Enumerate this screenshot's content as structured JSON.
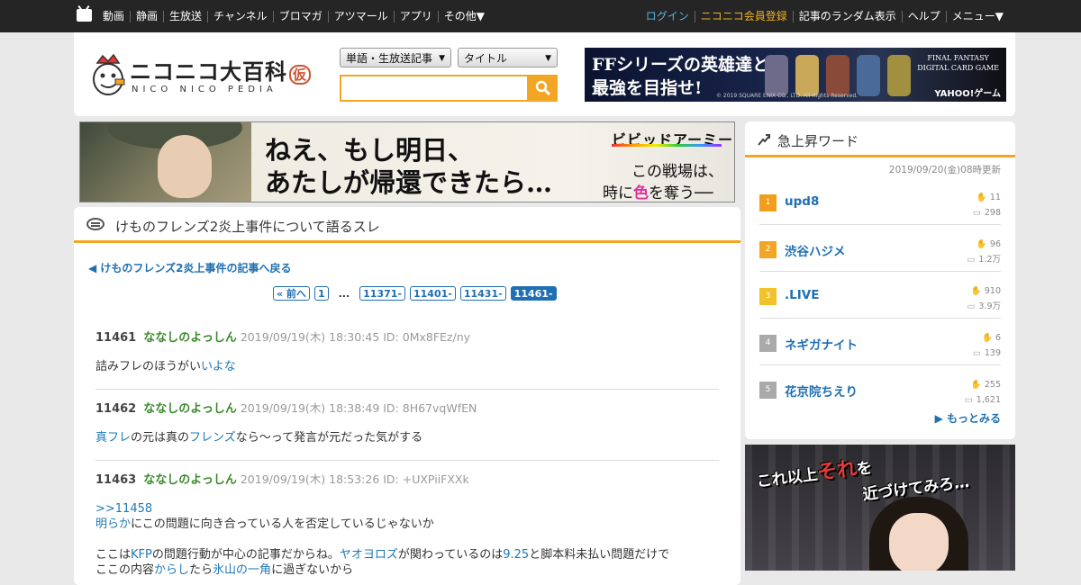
{
  "topnav": {
    "left": [
      "動画",
      "静画",
      "生放送",
      "チャンネル",
      "ブロマガ",
      "アツマール",
      "アプリ",
      "その他▼"
    ],
    "right": [
      {
        "label": "ログイン",
        "kind": "login"
      },
      {
        "label": "ニコニコ会員登録",
        "kind": "register"
      },
      {
        "label": "記事のランダム表示",
        "kind": "normal"
      },
      {
        "label": "ヘルプ",
        "kind": "normal"
      },
      {
        "label": "メニュー▼",
        "kind": "normal"
      }
    ]
  },
  "header": {
    "logo_title": "ニコニコ大百科",
    "logo_kari": "仮",
    "logo_sub": "NICO NICO PEDIA",
    "search_scope": "単語・生放送記事",
    "search_field": "タイトル",
    "search_value": "",
    "ad": {
      "line1": "FFシリーズの英雄達と",
      "line2": "最強を目指せ!",
      "logo_line1": "FINAL FANTASY",
      "logo_line2": "DIGITAL CARD GAME",
      "yahoo": "YAHOO!ゲーム",
      "copyright": "© 2019 SQUARE ENIX CO., LTD. All Rights Reserved."
    }
  },
  "banner": {
    "line1": "ねえ、もし明日、",
    "line2": "あたしが帰還できたら…",
    "brand": "ビビッドアーミー",
    "right1": "この戦場は、",
    "right2_pre": "時に",
    "right2_em": "色",
    "right2_post": "を奪う──"
  },
  "thread": {
    "title": "けものフレンズ2炎上事件について語るスレ",
    "back_link": "◀ けものフレンズ2炎上事件の記事へ戻る",
    "pager": [
      {
        "label": "« 前へ",
        "current": false
      },
      {
        "label": "1",
        "current": false
      },
      {
        "label": "...",
        "dots": true
      },
      {
        "label": "11371-",
        "current": false
      },
      {
        "label": "11401-",
        "current": false
      },
      {
        "label": "11431-",
        "current": false
      },
      {
        "label": "11461-",
        "current": true
      }
    ],
    "posts": [
      {
        "no": "11461",
        "name": "ななしのよっしん",
        "meta": "2019/09/19(木) 18:30:45 ID: 0Mx8FEz/ny",
        "lines": [
          [
            [
              "詰みフレのほうがい",
              false
            ],
            [
              "いよな",
              true
            ]
          ]
        ]
      },
      {
        "no": "11462",
        "name": "ななしのよっしん",
        "meta": "2019/09/19(木) 18:38:49 ID: 8H67vqWfEN",
        "lines": [
          [
            [
              "真フレ",
              true
            ],
            [
              "の元は真の",
              false
            ],
            [
              "フレンズ",
              true
            ],
            [
              "なら～って発言が元だった気がする",
              false
            ]
          ]
        ]
      },
      {
        "no": "11463",
        "name": "ななしのよっしん",
        "meta": "2019/09/19(木) 18:53:26 ID: +UXPiiFXXk",
        "lines": [
          [
            [
              ">>11458",
              true
            ]
          ],
          [
            [
              "明らか",
              true
            ],
            [
              "にこの問題に向き合っている人を否定しているじゃないか",
              false
            ]
          ],
          [
            [
              "",
              false
            ]
          ],
          [
            [
              "ここは",
              false
            ],
            [
              "KFP",
              true
            ],
            [
              "の問題行動が中心の記事だからね。",
              false
            ],
            [
              "ヤオヨロズ",
              true
            ],
            [
              "が関わっているのは",
              false
            ],
            [
              "9.25",
              true
            ],
            [
              "と脚本料未払い問題だけで",
              false
            ]
          ],
          [
            [
              "ここの内容",
              false
            ],
            [
              "からし",
              true
            ],
            [
              "たら",
              false
            ],
            [
              "氷山の一角",
              true
            ],
            [
              "に過ぎないから",
              false
            ]
          ]
        ]
      }
    ]
  },
  "trending": {
    "title": "急上昇ワード",
    "updated": "2019/09/20(金)08時更新",
    "more": "▶ もっとみる",
    "items": [
      {
        "rank": "1",
        "word": "upd8",
        "a": "11",
        "b": "298",
        "color": "#f29d1c"
      },
      {
        "rank": "2",
        "word": "渋谷ハジメ",
        "a": "96",
        "b": "1.2万",
        "color": "#f2a623"
      },
      {
        "rank": "3",
        "word": ".LIVE",
        "a": "910",
        "b": "3.9万",
        "color": "#f2c22b"
      },
      {
        "rank": "4",
        "word": "ネギガナイト",
        "a": "6",
        "b": "139",
        "color": "#aaaaaa"
      },
      {
        "rank": "5",
        "word": "花京院ちえり",
        "a": "255",
        "b": "1,621",
        "color": "#aaaaaa"
      }
    ]
  },
  "manga_ad": {
    "line1_pre": "これ以上",
    "line1_em": "それ",
    "line1_post": "を",
    "line2": "近づけてみろ…"
  }
}
